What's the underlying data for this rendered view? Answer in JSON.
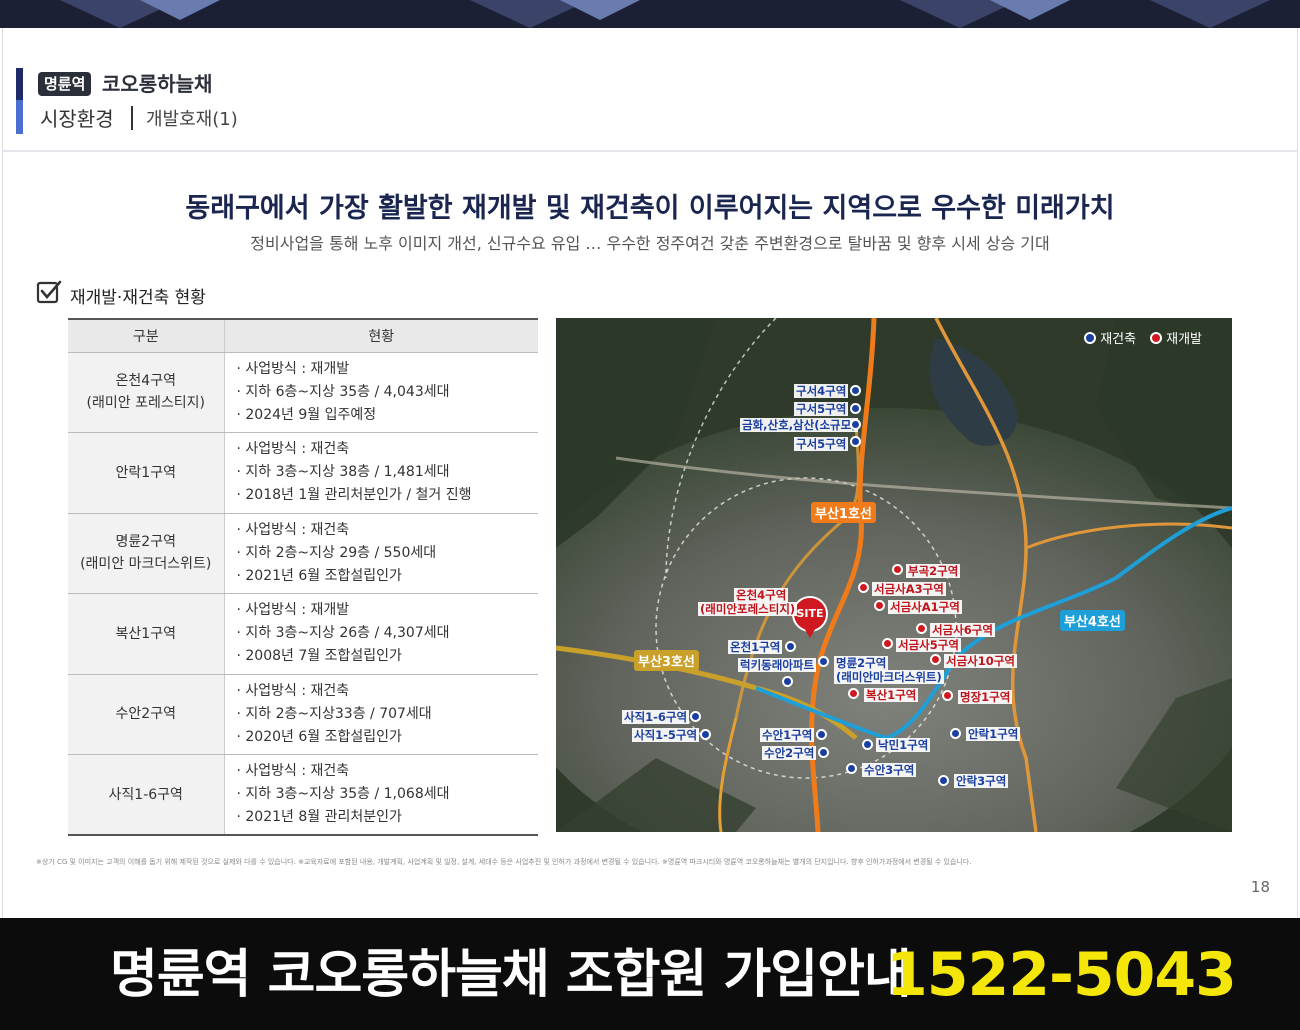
{
  "header": {
    "badge": "명륜역",
    "brand": "코오롱하늘채",
    "section": "시장환경",
    "subsection": "개발호재(1)"
  },
  "headline": "동래구에서 가장 활발한 재개발 및 재건축이 이루어지는 지역으로 우수한 미래가치",
  "subheadline": "정비사업을 통해 노후 이미지 개선, 신규수요 유입 … 우수한 정주여건 갖춘 주변환경으로 탈바꿈 및 향후 시세 상승 기대",
  "section_title": "재개발·재건축 현황",
  "table": {
    "headers": [
      "구분",
      "현황"
    ],
    "rows": [
      {
        "name": "온천4구역",
        "name2": "(래미안 포레스티지)",
        "lines": [
          "· 사업방식 : 재개발",
          "· 지하 6층~지상 35층 / 4,043세대",
          "· 2024년 9월 입주예정"
        ]
      },
      {
        "name": "안락1구역",
        "name2": "",
        "lines": [
          "· 사업방식 : 재건축",
          "· 지하 3층~지상 38층 / 1,481세대",
          "· 2018년 1월 관리처분인가 / 철거 진행"
        ]
      },
      {
        "name": "명륜2구역",
        "name2": "(래미안 마크더스위트)",
        "lines": [
          "· 사업방식 : 재건축",
          "· 지하 2층~지상 29층 / 550세대",
          "· 2021년 6월 조합설립인가"
        ]
      },
      {
        "name": "복산1구역",
        "name2": "",
        "lines": [
          "· 사업방식 : 재개발",
          "· 지하 3층~지상 26층 / 4,307세대",
          "· 2008년 7월 조합설립인가"
        ]
      },
      {
        "name": "수안2구역",
        "name2": "",
        "lines": [
          "· 사업방식 : 재건축",
          "· 지하 2층~지상33층 / 707세대",
          "· 2020년 6월 조합설립인가"
        ]
      },
      {
        "name": "사직1-6구역",
        "name2": "",
        "lines": [
          "· 사업방식 : 재건축",
          "· 지하 3층~지상 35층 / 1,068세대",
          "· 2021년 8월 관리처분인가"
        ]
      }
    ]
  },
  "map": {
    "legend": {
      "rebuild": "재건축",
      "redevelop": "재개발"
    },
    "lines": {
      "line1": "부산1호선",
      "line3": "부산3호선",
      "line4": "부산4호선"
    },
    "site": "SITE",
    "labels": {
      "guseo4": "구서4구역",
      "guseo5a": "구서5구역",
      "geumhwa": "금화,산호,삼산(소규모)",
      "guseo5b": "구서5구역",
      "oncheon4": "온천4구역",
      "oncheon4b": "(래미안포레스티지)",
      "bugok2": "부곡2구역",
      "seogeum_a3": "서금사A3구역",
      "seogeum_a1": "서금사A1구역",
      "seogeum6": "서금사6구역",
      "seogeum5": "서금사5구역",
      "seogeum10": "서금사10구역",
      "oncheon1": "온천1구역",
      "ruckydong": "럭키동래아파트",
      "myeongryun2": "명륜2구역",
      "myeongryun2b": "(래미안마크더스위트)",
      "boksan1": "복산1구역",
      "myeongjang1": "명장1구역",
      "sajik16": "사직1-6구역",
      "sajik15": "사직1-5구역",
      "suan1": "수안1구역",
      "suan2": "수안2구역",
      "nakmin1": "낙민1구역",
      "anrak1": "안락1구역",
      "suan3": "수안3구역",
      "anrak3": "안락3구역"
    },
    "colors": {
      "line1": "#f07b1a",
      "line3": "#c9a02a",
      "line4": "#1e9fd8",
      "marker_blue": "#1a3fa0",
      "marker_red": "#d01820"
    }
  },
  "disclaimer": "※상기 CG 및 이미지는 고객의 이해를 돕기 위해 제작된 것으로 실제와 다를 수 있습니다. ※교육자료에 포함된 내용, 개발계획, 사업계획 및 일정, 설계, 세대수 등은 사업추진 및 인허가 과정에서 변경될 수 있습니다. ※명륜역 파크시티와 명륜역 코오롱하늘채는 별개의 단지입니다. 향후 인허가과정에서  변경될 수 있습니다.",
  "page_number": "18",
  "banner": {
    "text": "명륜역 코오롱하늘채 조합원 가입안내",
    "phone": "1522-5043",
    "phone_color": "#f5e60a"
  }
}
